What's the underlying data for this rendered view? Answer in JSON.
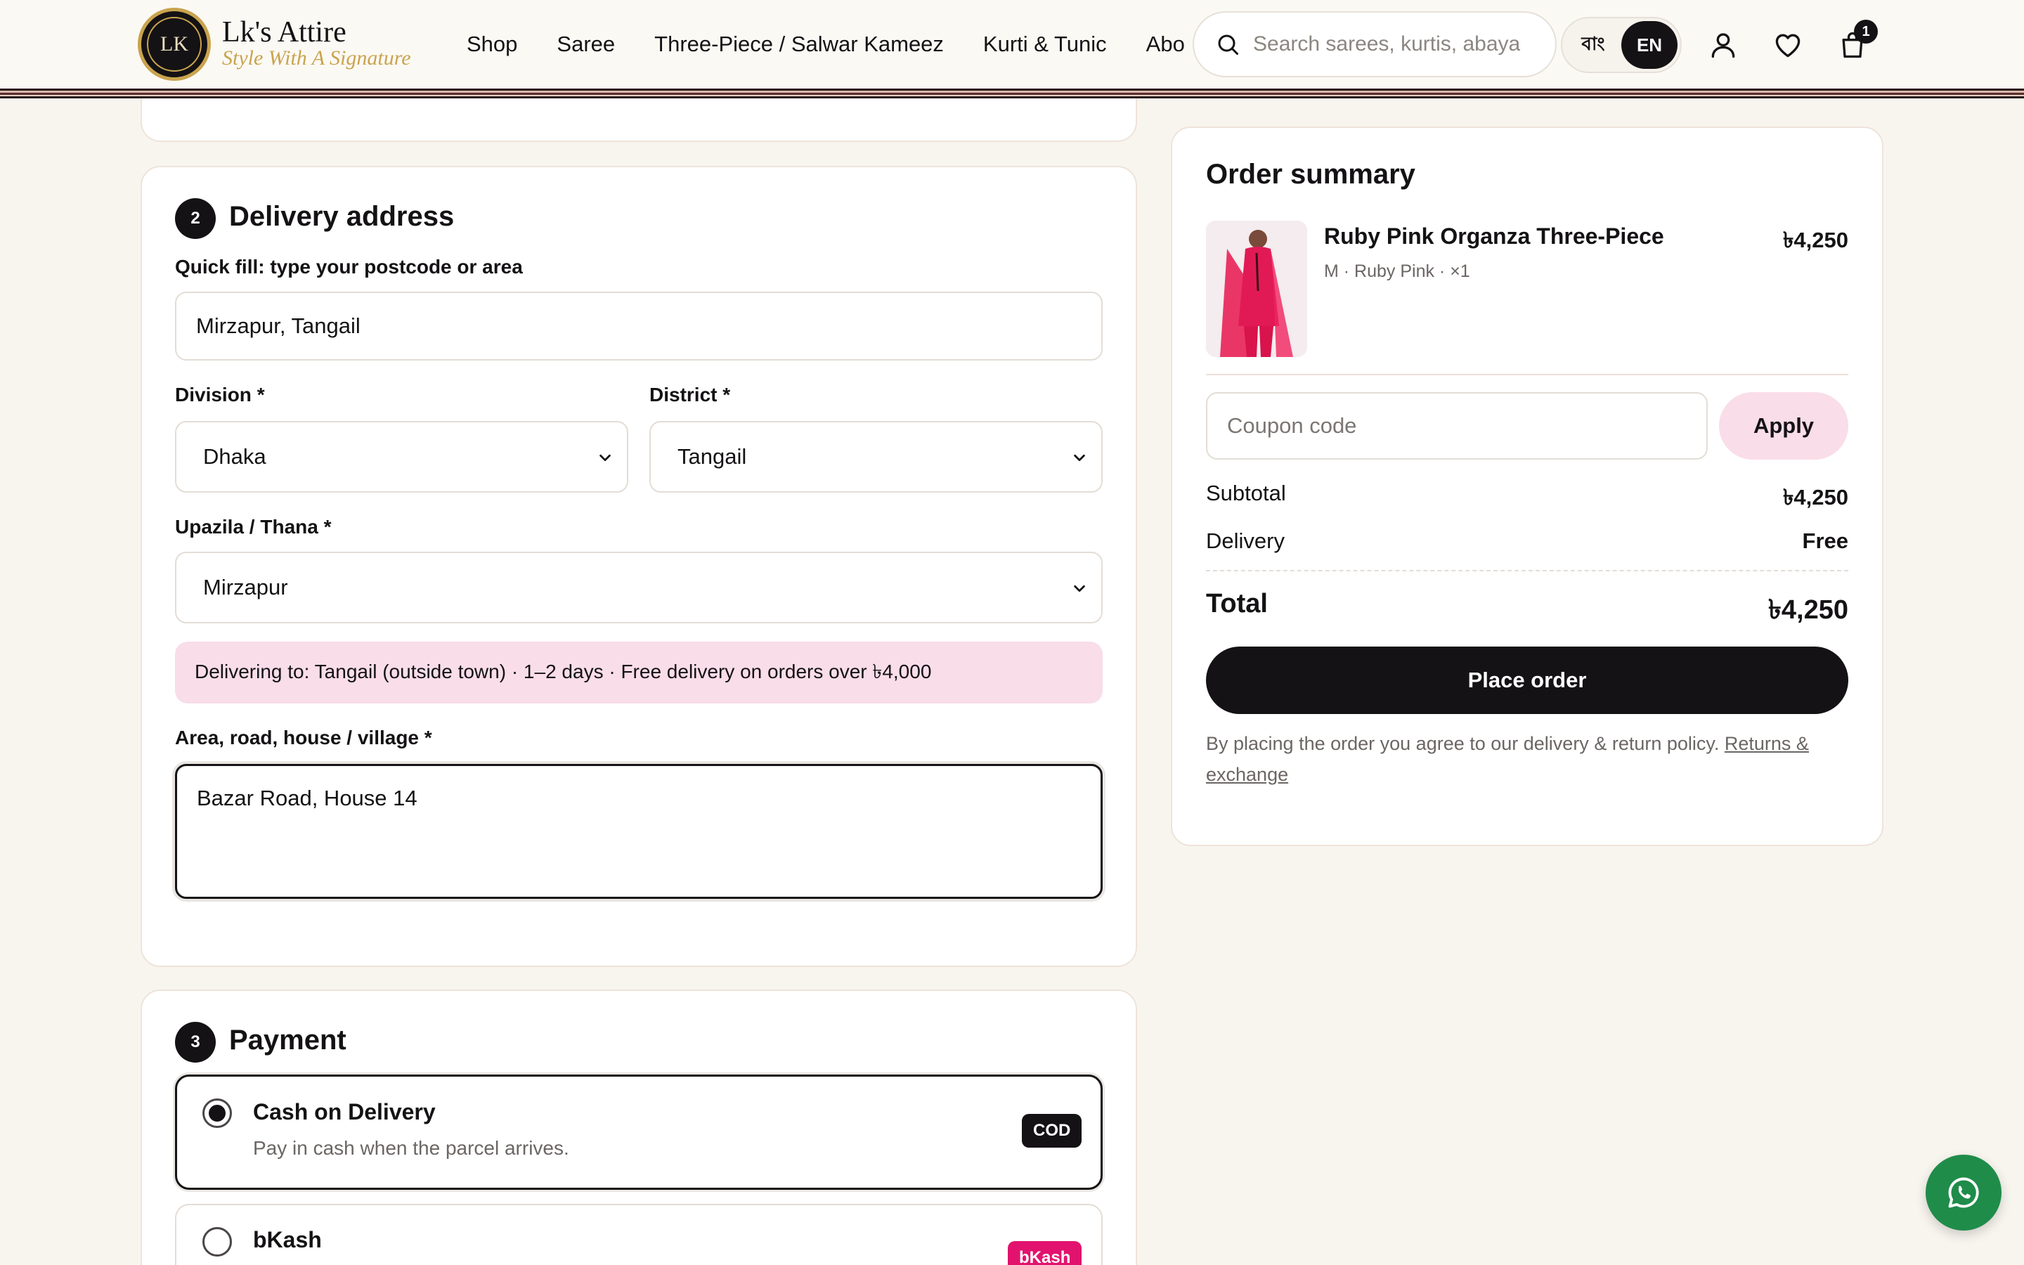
{
  "header": {
    "logo_monogram": "LK",
    "brand_name": "Lk's Attire",
    "tagline": "Style With A Signature",
    "nav": [
      "Shop",
      "Saree",
      "Three-Piece / Salwar Kameez",
      "Kurti & Tunic",
      "About"
    ],
    "search_placeholder": "Search sarees, kurtis, abayas",
    "lang_bn": "বাং",
    "lang_en": "EN",
    "cart_count": "1",
    "icons": [
      "search-icon",
      "user-icon",
      "heart-icon",
      "bag-icon"
    ]
  },
  "delivery": {
    "step": "2",
    "title": "Delivery address",
    "quick_fill_label": "Quick fill: type your postcode or area",
    "quick_fill_value": "Mirzapur, Tangail",
    "division_label": "Division *",
    "division_value": "Dhaka",
    "district_label": "District *",
    "district_value": "Tangail",
    "upazila_label": "Upazila / Thana *",
    "upazila_value": "Mirzapur",
    "notice": "Delivering to: Tangail (outside town) · 1–2 days · Free delivery on orders over ৳4,000",
    "address_label": "Area, road, house / village *",
    "address_value": "Bazar Road, House 14"
  },
  "payment": {
    "step": "3",
    "title": "Payment",
    "options": [
      {
        "name": "Cash on Delivery",
        "desc": "Pay in cash when the parcel arrives.",
        "badge": "COD",
        "selected": true
      },
      {
        "name": "bKash",
        "desc": "",
        "badge": "bKash",
        "selected": false
      }
    ]
  },
  "summary": {
    "title": "Order summary",
    "item_name": "Ruby Pink Organza Three-Piece",
    "item_meta": "M · Ruby Pink · ×1",
    "item_price": "৳4,250",
    "coupon_placeholder": "Coupon code",
    "apply_label": "Apply",
    "subtotal_label": "Subtotal",
    "subtotal_value": "৳4,250",
    "delivery_label": "Delivery",
    "delivery_value": "Free",
    "total_label": "Total",
    "total_value": "৳4,250",
    "place_order_label": "Place order",
    "policy_text": "By placing the order you agree to our delivery & return policy. ",
    "policy_link": "Returns & exchange"
  },
  "colors": {
    "accent_pink": "#f9dde8",
    "dark": "#141214",
    "bkash": "#e2136e",
    "whatsapp": "#1f8c4a",
    "gold": "#c9a44e"
  }
}
